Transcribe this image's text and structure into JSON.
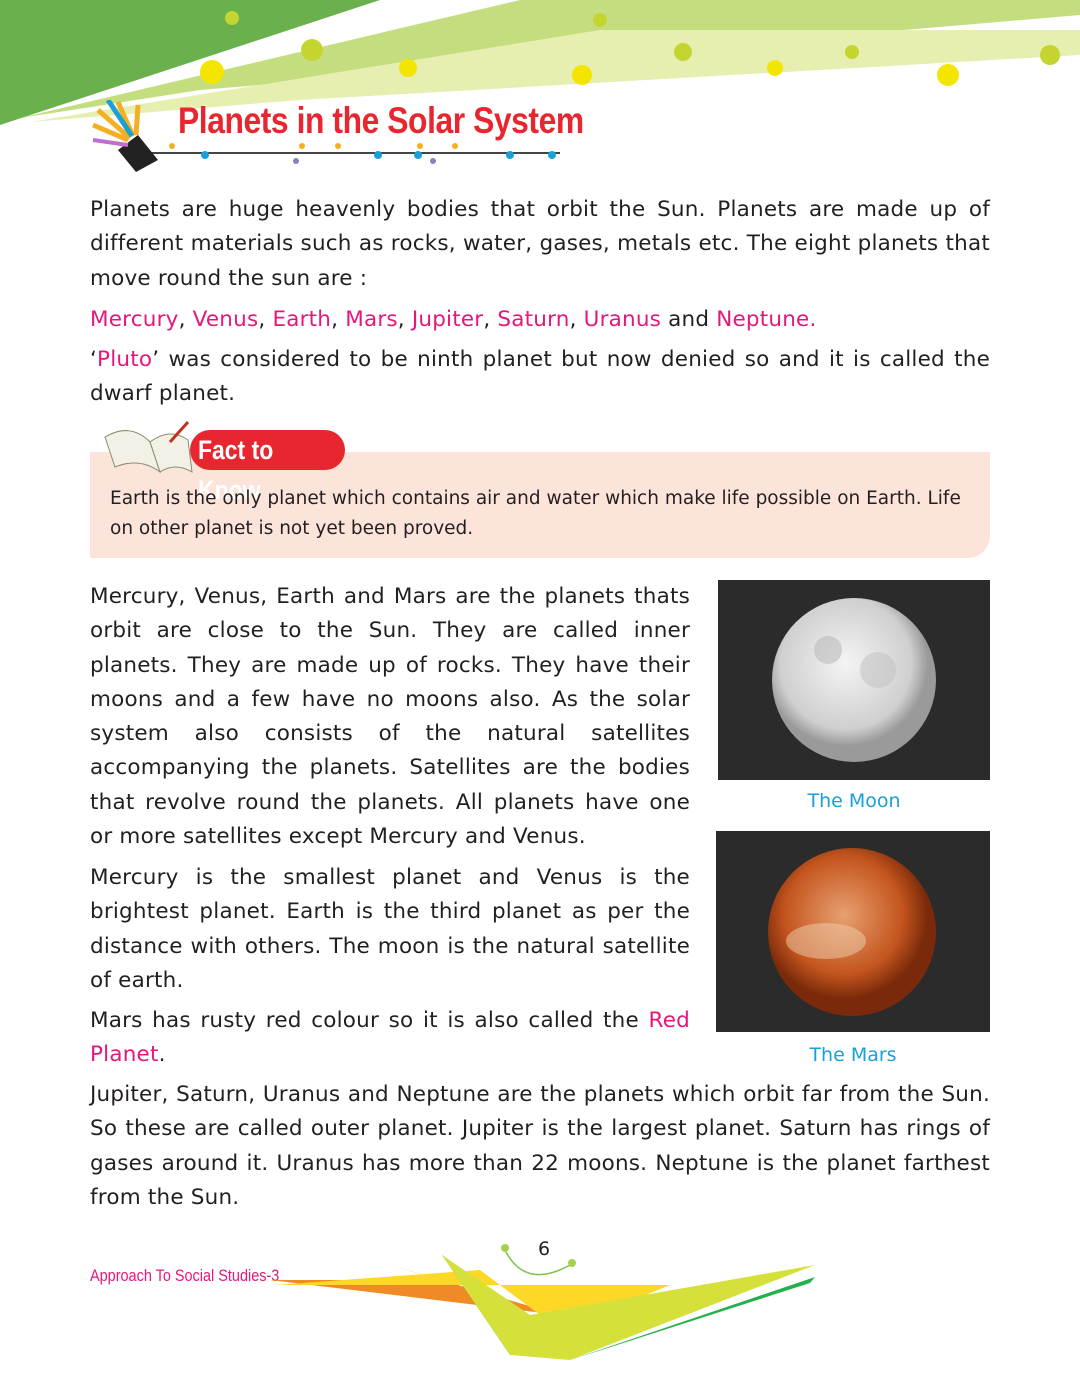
{
  "header": {
    "title": "Planets in the Solar System"
  },
  "intro": {
    "p1": "Planets are huge heavenly bodies that orbit the Sun. Planets are made up of different  materials such as rocks, water, gases, metals etc. The eight planets that move round the sun are :",
    "planets": [
      "Mercury",
      "Venus",
      "Earth",
      "Mars",
      "Jupiter",
      "Saturn",
      "Uranus"
    ],
    "and_text": " and ",
    "last_planet": "Neptune.",
    "pluto_pre": "‘",
    "pluto": "Pluto",
    "pluto_post": "’ was considered to be ninth planet but now denied so and it is called the dwarf planet."
  },
  "fact": {
    "title": "Fact to Know",
    "text": "Earth is the only planet which contains air and water which make life possible on Earth. Life on other planet is not yet been proved."
  },
  "body": {
    "p2": "Mercury, Venus, Earth and Mars are the planets thats orbit are close to the Sun. They are called inner planets. They are made up of rocks. They have their moons and a few have no moons also. As the solar system also consists of the natural satellites accompanying the planets. Satellites are the bodies that revolve round the planets. All planets have one or more satellites except Mercury and Venus.",
    "p3": "Mercury is the smallest planet and Venus is the brightest planet. Earth is the third planet as per the distance with others. The moon is the natural satellite of earth.",
    "p4_pre": "Mars has rusty red colour so it is also called the ",
    "p4_highlight": "Red Planet",
    "p4_post": ".",
    "p5": "Jupiter, Saturn, Uranus and Neptune are the planets which orbit far from the Sun. So these are called outer planet. Jupiter is the largest planet. Saturn has rings of gases around it. Uranus has more than 22 moons. Neptune is the planet farthest from  the Sun."
  },
  "images": [
    {
      "caption": "The Moon"
    },
    {
      "caption": "The Mars"
    }
  ],
  "footer": {
    "book": "Approach To Social Studies-3",
    "page": "6"
  }
}
